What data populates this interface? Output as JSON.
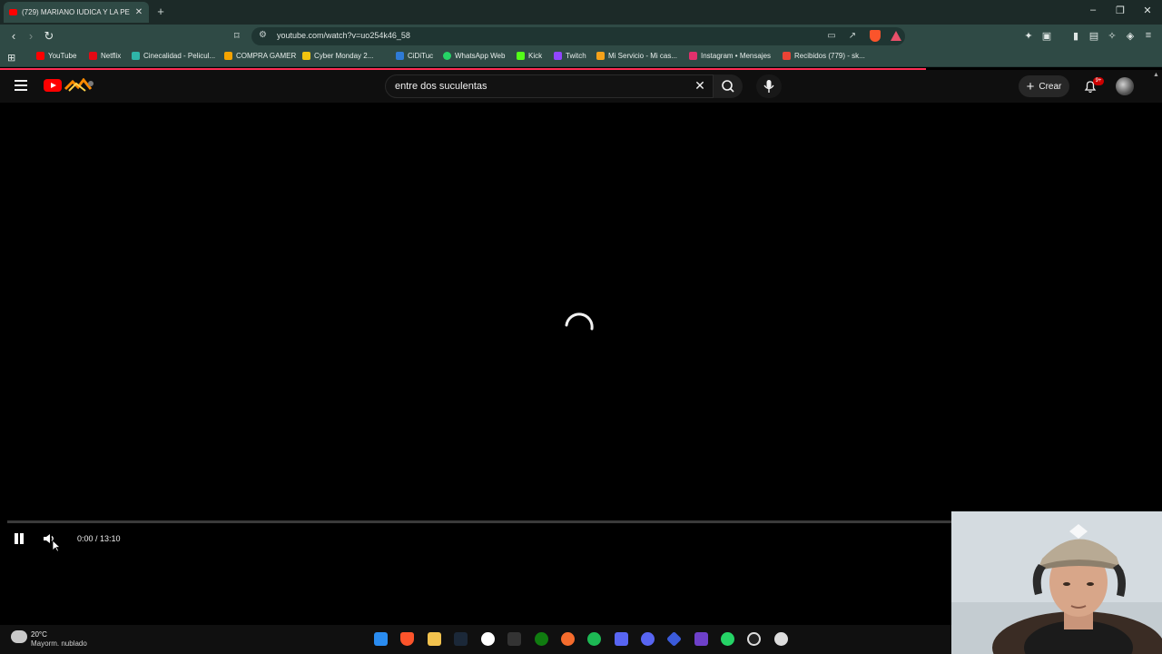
{
  "browser": {
    "tab_title": "(729) MARIANO IUDICA Y LA PE",
    "url": "youtube.com/watch?v=uo254k46_58",
    "new_tab": "+",
    "tab_close": "✕",
    "bookmarks": [
      {
        "label": "YouTube",
        "color": "#ff0000"
      },
      {
        "label": "Netflix",
        "color": "#e50914"
      },
      {
        "label": "Cinecalidad - Pelicul...",
        "color": "#2fb5a8"
      },
      {
        "label": "COMPRA GAMER",
        "color": "#f4a300"
      },
      {
        "label": "Cyber Monday 2...",
        "color": "#f1c40f"
      },
      {
        "label": "CiDiTuc",
        "color": "#2f7bd6"
      },
      {
        "label": "WhatsApp Web",
        "color": "#25d366"
      },
      {
        "label": "Kick",
        "color": "#53fc18"
      },
      {
        "label": "Twitch",
        "color": "#9146ff"
      },
      {
        "label": "Mi Servicio - Mi cas...",
        "color": "#f6a21a"
      },
      {
        "label": "Instagram • Mensajes",
        "color": "#e1306c"
      },
      {
        "label": "Recibidos (779) - sk...",
        "color": "#ea4335"
      }
    ]
  },
  "youtube": {
    "search_query": "entre dos suculentas",
    "create_label": "Crear",
    "notif_badge": "9+"
  },
  "player": {
    "time": "0:00 / 13:10",
    "progress": 0.0
  },
  "taskbar": {
    "temperature": "20°C",
    "condition": "Mayorm. nublado"
  },
  "colors": {
    "accent": "#ff0000",
    "page_bg": "#0f0f0f"
  }
}
